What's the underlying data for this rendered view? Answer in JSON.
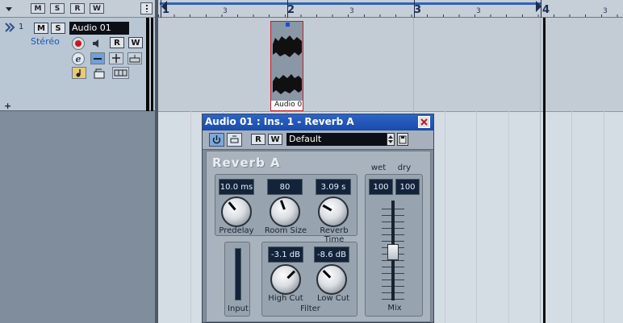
{
  "project": {
    "toolbar_buttons": [
      "M",
      "S",
      "R",
      "W"
    ]
  },
  "track": {
    "number": "1",
    "name": "Audio 01",
    "channel_mode": "Stéréo",
    "mute_label": "M",
    "solo_label": "S",
    "read_label": "R",
    "write_label": "W",
    "edit_label": "e"
  },
  "ruler": {
    "bars": [
      "1",
      "2",
      "3",
      "4"
    ],
    "beats": [
      "3",
      "3",
      "3",
      "3"
    ]
  },
  "clip": {
    "name": "Audio 0"
  },
  "plugin": {
    "title": "Audio 01 : Ins. 1 - Reverb A",
    "read_label": "R",
    "write_label": "W",
    "preset": "Default",
    "name": "Reverb A",
    "knobs": [
      {
        "label": "Predelay",
        "value": "10.0 ms"
      },
      {
        "label": "Room Size",
        "value": "80"
      },
      {
        "label": "Reverb Time",
        "value": "3.09 s"
      },
      {
        "label": "High Cut",
        "value": "-3.1 dB"
      },
      {
        "label": "Low Cut",
        "value": "-8.6 dB"
      }
    ],
    "input_label": "Input",
    "filter_label": "Filter",
    "mix": {
      "wet_label": "wet",
      "dry_label": "dry",
      "wet_value": "100",
      "dry_value": "100",
      "label": "Mix"
    }
  }
}
